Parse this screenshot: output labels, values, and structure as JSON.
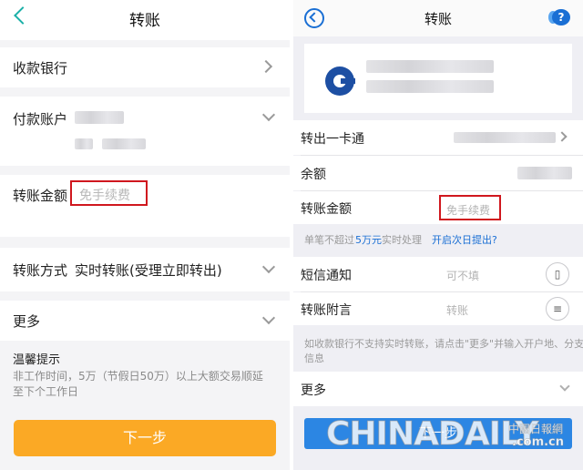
{
  "colors": {
    "accent_orange": "#fba925",
    "accent_blue": "#2c86e3",
    "highlight_red": "#d0171e",
    "link_blue": "#1a6fd4",
    "back_teal": "#1ab0a8"
  },
  "left": {
    "title": "转账",
    "back_icon": "back-arrow-icon",
    "payee_bank_label": "收款银行",
    "payer_account_label": "付款账户",
    "amount_label": "转账金额",
    "amount_placeholder": "免手续费",
    "method_label": "转账方式",
    "method_value": "实时转账(受理立即转出)",
    "more_label": "更多",
    "tip_title": "温馨提示",
    "tip_text_line1": "非工作时间，5万（节假日50万）以上大额交易顺延",
    "tip_text_line2": "至下个工作日",
    "next_button": "下一步"
  },
  "right": {
    "title": "转账",
    "help_icon": "help-chat-icon",
    "bank_logo_icon": "ccb-bank-logo-icon",
    "transfer_out_label": "转出一卡通",
    "balance_label": "余额",
    "amount_label": "转账金额",
    "amount_placeholder": "免手续费",
    "limit_note_prefix": "单笔不超过",
    "limit_note_value": "5万元",
    "limit_note_suffix": "实时处理",
    "next_day_link": "开启次日提出?",
    "sms_label": "短信通知",
    "sms_placeholder": "可不填",
    "message_label": "转账附言",
    "message_placeholder": "转账",
    "tip_line1": "如收款银行不支持实时转账，请点击\"更多\"并输入开户地、分支行",
    "tip_line2": "信息",
    "more_label": "更多",
    "next_button": "下一步"
  },
  "watermark": {
    "brand": "CHINADAILY",
    "cn": "中國日報網",
    "domain": ".com.cn"
  }
}
